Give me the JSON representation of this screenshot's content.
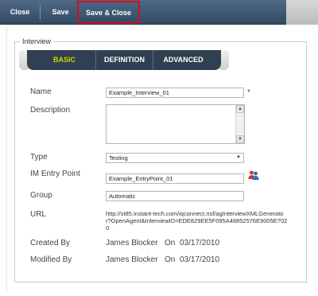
{
  "toolbar": {
    "close_label": "Close",
    "save_label": "Save",
    "save_close_label": "Save & Close"
  },
  "section": {
    "legend": "Interview"
  },
  "tabs": [
    {
      "label": "BASIC",
      "active": true
    },
    {
      "label": "DEFINITION",
      "active": false
    },
    {
      "label": "ADVANCED",
      "active": false
    }
  ],
  "form": {
    "name": {
      "label": "Name",
      "value": "Example_Interview_01",
      "required_marker": "*"
    },
    "description": {
      "label": "Description",
      "value": ""
    },
    "type": {
      "label": "Type",
      "value": "Testing"
    },
    "entry_point": {
      "label": "IM Entry Point",
      "value": "Example_EntryPoint_01",
      "icon": "people-picker-icon"
    },
    "group": {
      "label": "Group",
      "value": "Automatic"
    },
    "url": {
      "label": "URL",
      "value": "http://st85.instant-tech.com/iqconnect.nsf/agInterviewXMLGenerator?OpenAgent&InterviewID=EDE829EE5F095A48852576E9005E7020"
    },
    "created_by": {
      "label": "Created By",
      "user": "James Blocker",
      "on": "On",
      "date": "03/17/2010"
    },
    "modified_by": {
      "label": "Modified By",
      "user": "James Blocker",
      "on": "On",
      "date": "03/17/2010"
    }
  },
  "colors": {
    "toolbar": "#3d566f",
    "tabbar": "#2f4052",
    "active_tab": "#c9d400",
    "highlight": "#d10f1f"
  }
}
